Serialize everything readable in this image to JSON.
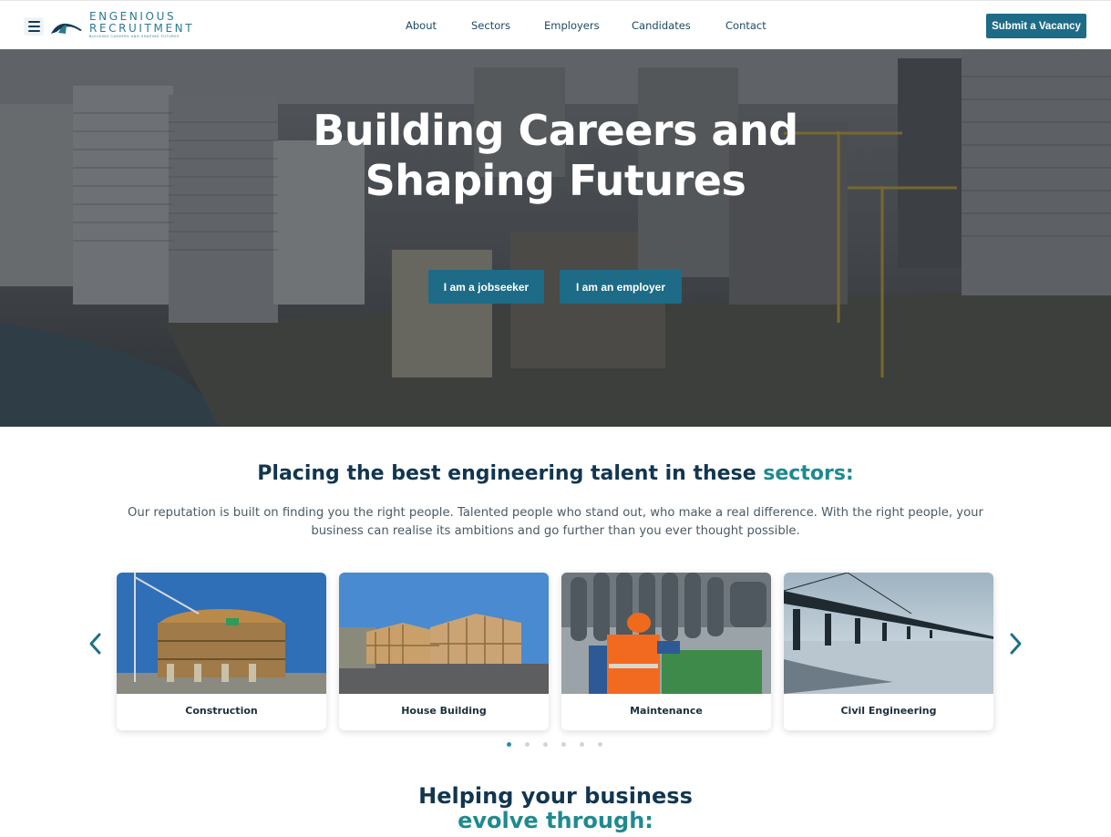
{
  "header": {
    "logo_name_line1": "ENGENIOUS",
    "logo_name_line2": "RECRUITMENT",
    "logo_tagline": "BUILDING CAREERS AND SHAPING FUTURES",
    "nav": [
      {
        "label": "About"
      },
      {
        "label": "Sectors"
      },
      {
        "label": "Employers"
      },
      {
        "label": "Candidates"
      },
      {
        "label": "Contact"
      }
    ],
    "cta_label": "Submit a Vacancy"
  },
  "hero": {
    "title_line1": "Building Careers and",
    "title_line2": "Shaping Futures",
    "jobseeker_label": "I am a jobseeker",
    "employer_label": "I am an employer"
  },
  "sectors": {
    "title_main": "Placing the best engineering talent in these ",
    "title_accent": "sectors:",
    "description": "Our reputation is built on finding you the right people. Talented people who stand out, who make a real difference. With the right people, your business can realise its ambitions and go further than you ever thought possible.",
    "cards": [
      {
        "label": "Construction"
      },
      {
        "label": "House Building"
      },
      {
        "label": "Maintenance"
      },
      {
        "label": "Civil Engineering"
      }
    ],
    "dot_count": 6,
    "active_dot": 1
  },
  "help": {
    "title_line1": "Helping your business",
    "title_line2": "evolve through:"
  },
  "colors": {
    "brand": "#1d6b86",
    "accent": "#1f8a8f",
    "heading": "#123650"
  }
}
